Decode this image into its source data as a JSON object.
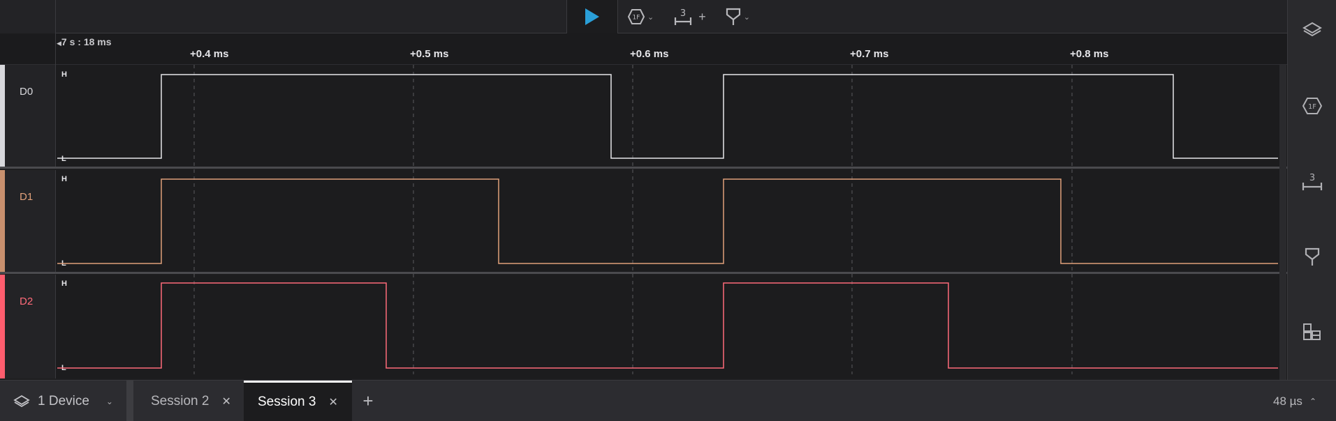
{
  "toolbar": {
    "play_icon": "play-icon",
    "analyzer_icon": "hex-1f-icon",
    "measure_icon": "measure-3-icon",
    "measure_number": "3",
    "measure_plus": "+",
    "marker_icon": "marker-pin-icon"
  },
  "ruler": {
    "origin": "7 s : 18 ms",
    "ticks": [
      {
        "label": "+0.4 ms"
      },
      {
        "label": "+0.5 ms"
      },
      {
        "label": "+0.6 ms"
      },
      {
        "label": "+0.7 ms"
      },
      {
        "label": "+0.8 ms"
      }
    ]
  },
  "channels": [
    {
      "name": "D0",
      "color": "#d8d8dc",
      "high": "H",
      "low": "L"
    },
    {
      "name": "D1",
      "color": "#e0a07a",
      "high": "H",
      "low": "L"
    },
    {
      "name": "D2",
      "color": "#ff6b7a",
      "high": "H",
      "low": "L"
    }
  ],
  "sidebar": {
    "items": [
      {
        "icon": "layers-icon"
      },
      {
        "icon": "hex-1f-icon"
      },
      {
        "icon": "measure-3-icon",
        "number": "3"
      },
      {
        "icon": "marker-pin-icon"
      },
      {
        "icon": "extensions-icon"
      }
    ]
  },
  "bottom": {
    "device_label": "1 Device",
    "tabs": [
      {
        "label": "Session 2",
        "active": false
      },
      {
        "label": "Session 3",
        "active": true
      }
    ],
    "add_tab": "+",
    "zoom": "48 µs"
  },
  "colors": {
    "accent_play": "#2a9fd8",
    "background": "#1c1c1e"
  }
}
